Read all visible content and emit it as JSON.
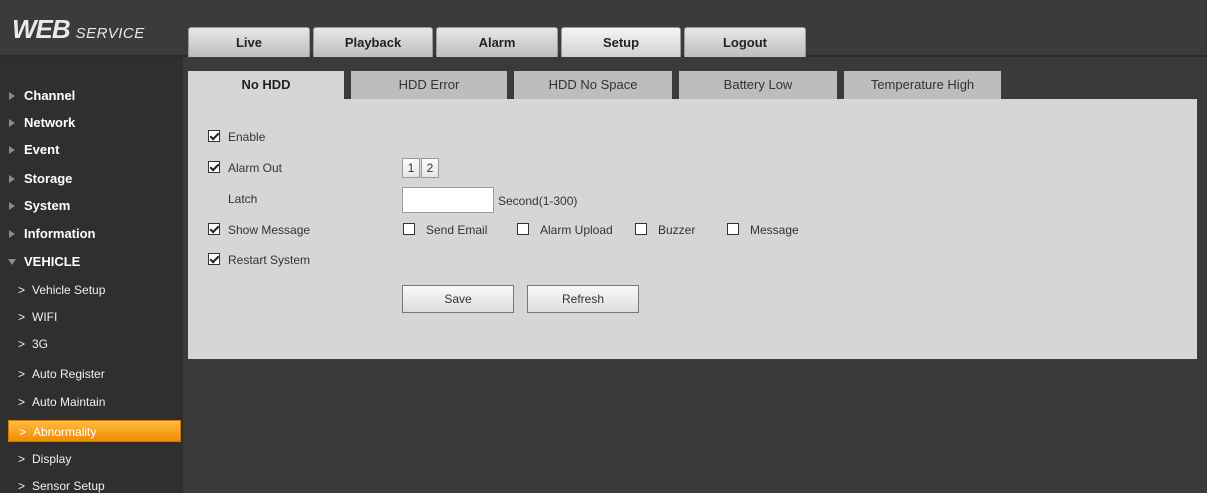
{
  "header": {
    "logo_main": "WEB",
    "logo_sub": "SERVICE",
    "tabs": [
      {
        "label": "Live"
      },
      {
        "label": "Playback"
      },
      {
        "label": "Alarm"
      },
      {
        "label": "Setup"
      },
      {
        "label": "Logout"
      }
    ],
    "active_tab": "Setup"
  },
  "sidebar": {
    "sections": [
      {
        "label": "Channel",
        "expanded": false
      },
      {
        "label": "Network",
        "expanded": false
      },
      {
        "label": "Event",
        "expanded": false
      },
      {
        "label": "Storage",
        "expanded": false
      },
      {
        "label": "System",
        "expanded": false
      },
      {
        "label": "Information",
        "expanded": false
      },
      {
        "label": "VEHICLE",
        "expanded": true
      }
    ],
    "sub_items": [
      {
        "label": "Vehicle Setup"
      },
      {
        "label": "WIFI"
      },
      {
        "label": "3G"
      },
      {
        "label": "Auto Register"
      },
      {
        "label": "Auto Maintain"
      },
      {
        "label": "Abnormality"
      },
      {
        "label": "Display"
      },
      {
        "label": "Sensor Setup"
      }
    ],
    "sub_arrow": ">",
    "active_sub_item": "Abnormality",
    "active_color": "#f5a000"
  },
  "subtabs": [
    {
      "label": "No HDD"
    },
    {
      "label": "HDD Error"
    },
    {
      "label": "HDD No Space"
    },
    {
      "label": "Battery Low"
    },
    {
      "label": "Temperature High"
    }
  ],
  "active_subtab": "No HDD",
  "form": {
    "enable": {
      "label": "Enable",
      "checked": true
    },
    "alarm_out": {
      "label": "Alarm Out",
      "checked": true,
      "channels": [
        "1",
        "2"
      ]
    },
    "latch": {
      "label": "Latch",
      "value": "",
      "unit": "Second(1-300)"
    },
    "show_message": {
      "label": "Show Message",
      "checked": true
    },
    "send_email": {
      "label": "Send Email",
      "checked": false
    },
    "alarm_upload": {
      "label": "Alarm Upload",
      "checked": false
    },
    "buzzer": {
      "label": "Buzzer",
      "checked": false
    },
    "message": {
      "label": "Message",
      "checked": false
    },
    "restart_system": {
      "label": "Restart System",
      "checked": true
    },
    "save_label": "Save",
    "refresh_label": "Refresh"
  }
}
